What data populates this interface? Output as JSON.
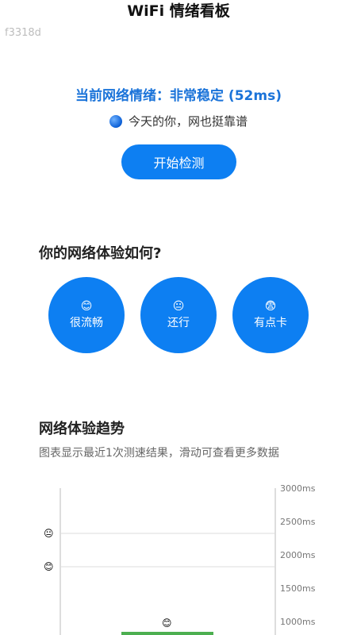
{
  "header": {
    "title": "WiFi 情绪看板",
    "device_id": "f3318d"
  },
  "status": {
    "mood_text": "当前网络情绪：非常稳定 (52ms)",
    "sub_text": "今天的你，网也挺靠谱",
    "accent_color": "#1a73d9"
  },
  "actions": {
    "start_label": "开始检测"
  },
  "experience": {
    "title": "你的网络体验如何?",
    "options": [
      {
        "emoji": "😊",
        "label": "很流畅"
      },
      {
        "emoji": "😐",
        "label": "还行"
      },
      {
        "emoji": "😨",
        "label": "有点卡"
      }
    ]
  },
  "trend": {
    "title": "网络体验趋势",
    "subtitle": "图表显示最近1次测速结果，滑动可查看更多数据"
  },
  "chart_data": {
    "type": "bar",
    "y_ticks": [
      "3000ms",
      "2500ms",
      "2000ms",
      "1500ms",
      "1000ms"
    ],
    "ylim": [
      0,
      3000
    ],
    "values": [
      52
    ],
    "bar_color": "#4caf50",
    "y_axis_position": "right",
    "emoji_markers": [
      {
        "emoji": "😐",
        "y": 2000
      },
      {
        "emoji": "😊",
        "y": 1500
      },
      {
        "emoji": "😊",
        "y": 1000
      }
    ]
  }
}
